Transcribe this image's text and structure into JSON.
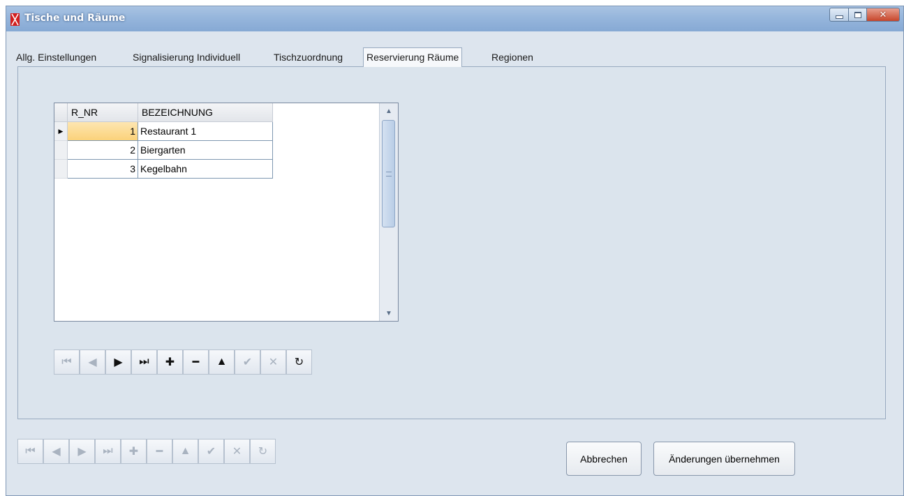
{
  "window": {
    "title": "Tische und Räume",
    "controls": {
      "minimize": "minimize-icon",
      "maximize": "maximize-icon",
      "close": "close-icon"
    },
    "accent_color": "#d21e1e"
  },
  "tabs": [
    {
      "label": "Allg. Einstellungen",
      "active": false
    },
    {
      "label": "Signalisierung Individuell",
      "active": false
    },
    {
      "label": "Tischzuordnung",
      "active": false
    },
    {
      "label": "Reservierung Räume",
      "active": true
    },
    {
      "label": "Regionen",
      "active": false
    }
  ],
  "grid": {
    "columns": [
      "R_NR",
      "BEZEICHNUNG"
    ],
    "rows": [
      {
        "r_nr": "1",
        "bezeichnung": "Restaurant 1",
        "current": true
      },
      {
        "r_nr": "2",
        "bezeichnung": "Biergarten",
        "current": false
      },
      {
        "r_nr": "3",
        "bezeichnung": "Kegelbahn",
        "current": false
      }
    ],
    "selection_color": "#fbd27a"
  },
  "inner_navigator": {
    "buttons": [
      {
        "icon": "first-record-icon",
        "glyph": "⏮",
        "enabled": false
      },
      {
        "icon": "prior-record-icon",
        "glyph": "◀",
        "enabled": false
      },
      {
        "icon": "next-record-icon",
        "glyph": "▶",
        "enabled": true
      },
      {
        "icon": "last-record-icon",
        "glyph": "⏭",
        "enabled": true
      },
      {
        "icon": "insert-icon",
        "glyph": "✚",
        "enabled": true
      },
      {
        "icon": "delete-icon",
        "glyph": "━",
        "enabled": true
      },
      {
        "icon": "edit-icon",
        "glyph": "▲",
        "enabled": true
      },
      {
        "icon": "post-icon",
        "glyph": "✔",
        "enabled": false
      },
      {
        "icon": "cancel-icon",
        "glyph": "✕",
        "enabled": false
      },
      {
        "icon": "refresh-icon",
        "glyph": "↻",
        "enabled": true
      }
    ]
  },
  "outer_navigator": {
    "buttons": [
      {
        "icon": "first-record-icon",
        "glyph": "⏮",
        "enabled": false
      },
      {
        "icon": "prior-record-icon",
        "glyph": "◀",
        "enabled": false
      },
      {
        "icon": "next-record-icon",
        "glyph": "▶",
        "enabled": false
      },
      {
        "icon": "last-record-icon",
        "glyph": "⏭",
        "enabled": false
      },
      {
        "icon": "insert-icon",
        "glyph": "✚",
        "enabled": false
      },
      {
        "icon": "delete-icon",
        "glyph": "━",
        "enabled": false
      },
      {
        "icon": "edit-icon",
        "glyph": "▲",
        "enabled": false
      },
      {
        "icon": "post-icon",
        "glyph": "✔",
        "enabled": false
      },
      {
        "icon": "cancel-icon",
        "glyph": "✕",
        "enabled": false
      },
      {
        "icon": "refresh-icon",
        "glyph": "↻",
        "enabled": false
      }
    ]
  },
  "footer": {
    "cancel_label": "Abbrechen",
    "apply_label": "Änderungen übernehmen"
  }
}
